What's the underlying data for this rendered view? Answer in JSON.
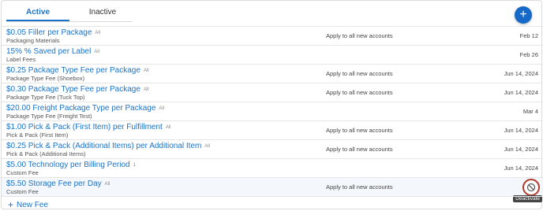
{
  "tabs": {
    "active": "Active",
    "inactive": "Inactive"
  },
  "fab_label": "+",
  "fees": [
    {
      "title": "$0.05 Filler per Package",
      "scope": "All",
      "type": "Packaging Materials",
      "apply": "Apply to all new accounts",
      "date": "Feb 12"
    },
    {
      "title": "15% % Saved per Label",
      "scope": "All",
      "type": "Label Fees",
      "apply": "",
      "date": "Feb 26"
    },
    {
      "title": "$0.25 Package Type Fee per Package",
      "scope": "All",
      "type": "Package Type Fee (Shoebox)",
      "apply": "Apply to all new accounts",
      "date": "Jun 14, 2024"
    },
    {
      "title": "$0.30 Package Type Fee per Package",
      "scope": "All",
      "type": "Package Type Fee (Tuck Top)",
      "apply": "Apply to all new accounts",
      "date": "Jun 14, 2024"
    },
    {
      "title": "$20.00 Freight Package Type per Package",
      "scope": "All",
      "type": "Package Type Fee (Freight Test)",
      "apply": "",
      "date": "Mar 4"
    },
    {
      "title": "$1.00 Pick & Pack (First Item) per Fulfillment",
      "scope": "All",
      "type": "Pick & Pack (First Item)",
      "apply": "Apply to all new accounts",
      "date": "Jun 14, 2024"
    },
    {
      "title": "$0.25 Pick & Pack (Additional Items) per Additional Item",
      "scope": "All",
      "type": "Pick & Pack (Additional Items)",
      "apply": "Apply to all new accounts",
      "date": "Jun 14, 2024"
    },
    {
      "title": "$5.00 Technology per Billing Period",
      "scope": "1",
      "type": "Custom Fee",
      "apply": "",
      "date": "Jun 14, 2024"
    },
    {
      "title": "$5.50 Storage Fee per Day",
      "scope": "All",
      "type": "Custom Fee",
      "apply": "Apply to all new accounts",
      "date": ""
    }
  ],
  "deactivate_tooltip": "Deactivate",
  "new_fee_label": "New Fee",
  "colors": {
    "accent": "#1a73c6",
    "fab": "#1669c7",
    "deactivate_ring": "#b03a2e"
  },
  "icons": {
    "add": "plus-icon",
    "deactivate": "deactivate-icon"
  }
}
